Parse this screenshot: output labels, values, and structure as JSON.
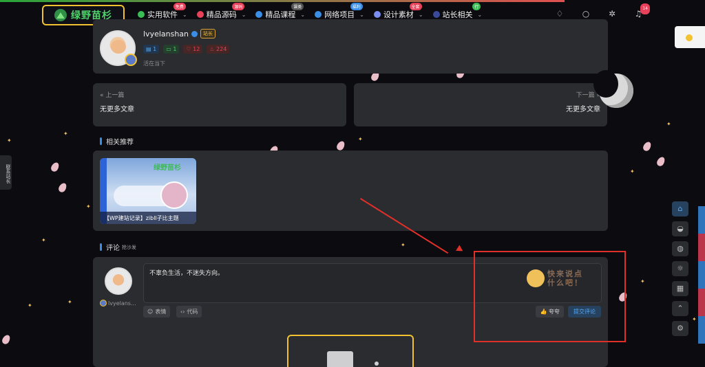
{
  "header": {
    "logo_text": "绿野苗杉",
    "nav": [
      {
        "label": "实用软件",
        "badge": "免费",
        "badge_color": "#e8415a",
        "dot_color": "#3bbd55"
      },
      {
        "label": "精品源码",
        "badge": "源码",
        "badge_color": "#e8415a",
        "dot_color": "#e8415a"
      },
      {
        "label": "精品课程",
        "badge": "课类",
        "badge_color": "#555",
        "dot_color": "#3a8ee6"
      },
      {
        "label": "网络项目",
        "badge": "福利",
        "badge_color": "#3a8ee6",
        "dot_color": "#3a8ee6"
      },
      {
        "label": "设计素材",
        "badge": "全套",
        "badge_color": "#e8415a",
        "dot_color": "#7a8df0"
      },
      {
        "label": "站长相关",
        "badge": "行",
        "badge_color": "#3bbd55",
        "dot_color": "#3a4a9a"
      }
    ],
    "notifications_count": "14"
  },
  "author": {
    "name": "lvyelanshan",
    "level_badge": "站长",
    "stats": [
      "1",
      "1",
      "12",
      "224"
    ],
    "status": "活在当下"
  },
  "prev": {
    "label": "上一篇",
    "title": "无更多文章"
  },
  "next": {
    "label": "下一篇",
    "title": "无更多文章"
  },
  "related": {
    "title": "相关推荐",
    "items": [
      {
        "thumb_logo": "绿野苗杉",
        "caption": "【WP建站记录】zibll子比主题"
      }
    ]
  },
  "comments": {
    "title": "评论",
    "subtitle": "抢沙发",
    "username": "lvyelans...",
    "placeholder": "不辜负生活，不迷失方向。",
    "mascot_text": "快来说点什么吧！",
    "emoji_label": "表情",
    "code_label": "代码",
    "like_label": "夸夸",
    "submit_label": "提交评论"
  },
  "side_tab": "联系站长",
  "colors": {
    "accent": "#3a8ee6",
    "highlight": "#f2c230",
    "annotation": "#e0302a",
    "bg": "#0b0b10"
  }
}
